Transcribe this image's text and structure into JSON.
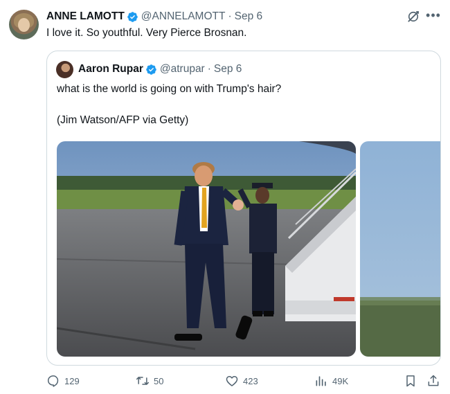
{
  "tweet": {
    "author_name": "ANNE LAMOTT",
    "author_handle": "@ANNELAMOTT",
    "separator": "·",
    "date": "Sep 6",
    "text": "I love it. So youthful. Very Pierce Brosnan."
  },
  "quoted": {
    "author_name": "Aaron Rupar",
    "author_handle": "@atrupar",
    "separator": "·",
    "date": "Sep 6",
    "text": "what is the world is going on with Trump's hair?",
    "credit": "(Jim Watson/AFP via Getty)"
  },
  "actions": {
    "replies": "129",
    "reposts": "50",
    "likes": "423",
    "views": "49K"
  },
  "colors": {
    "verified": "#1d9bf0",
    "muted": "#536471",
    "border": "#cfd9de"
  },
  "icons": [
    "verified-badge-icon",
    "grok-icon",
    "more-icon",
    "reply-icon",
    "repost-icon",
    "like-icon",
    "views-icon",
    "bookmark-icon",
    "share-icon"
  ]
}
